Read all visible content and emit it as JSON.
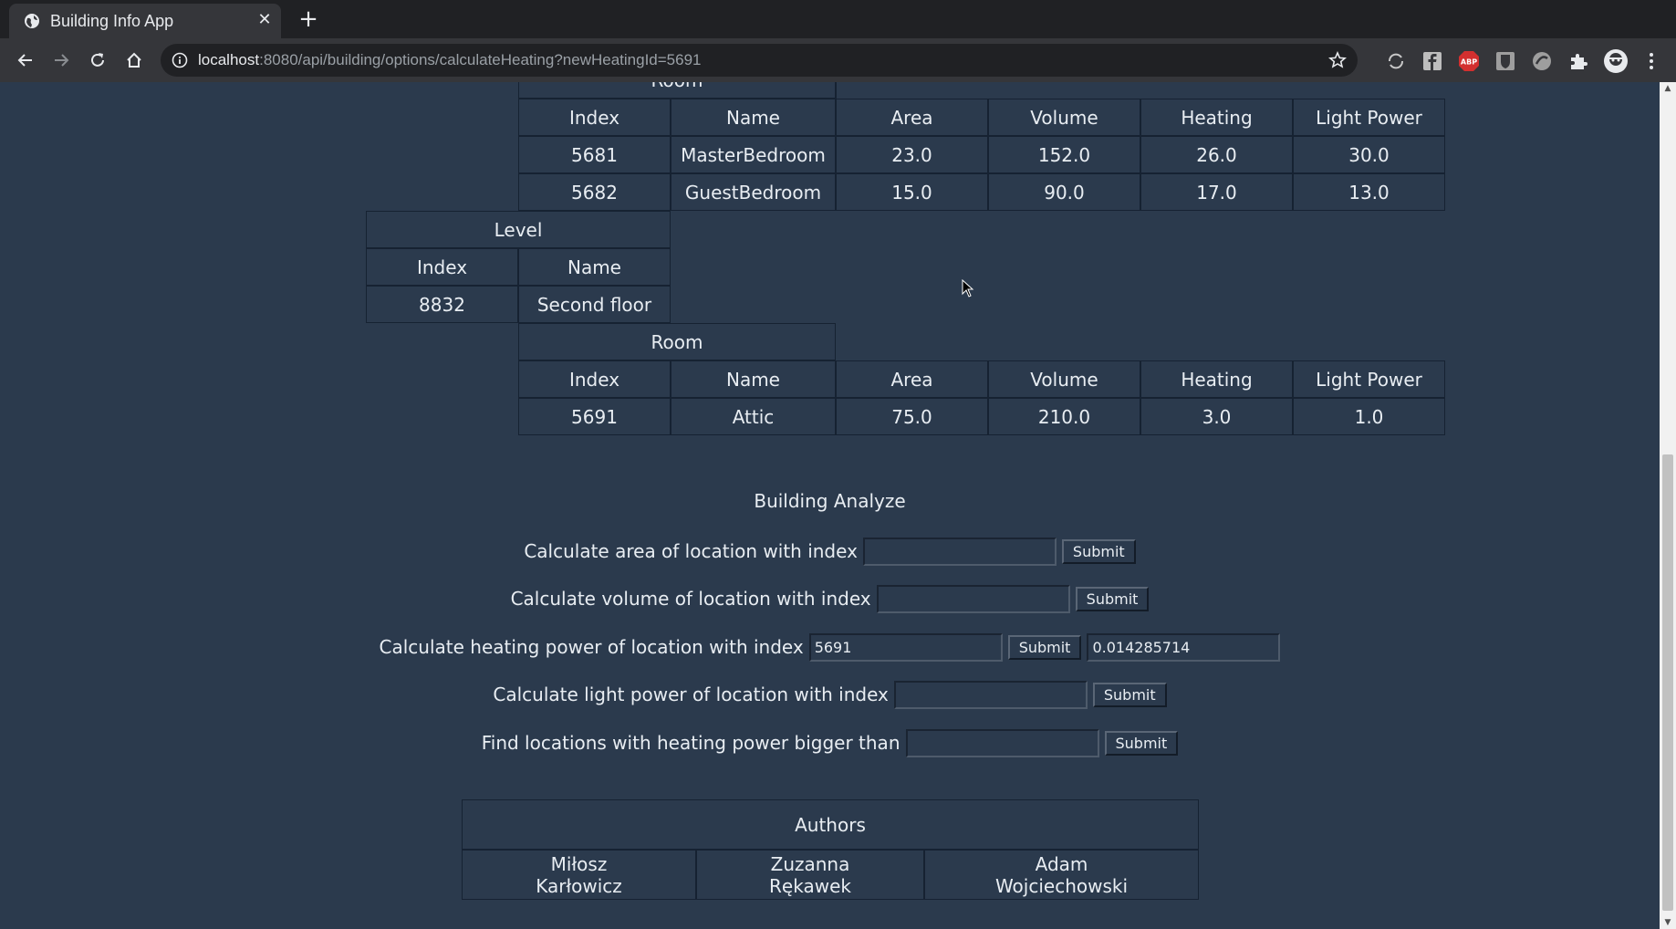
{
  "browser": {
    "tab_title": "Building Info App",
    "url_host": "localhost",
    "url_rest": ":8080/api/building/options/calculateHeating?newHeatingId=5691",
    "extension_icons": [
      "sync-icon",
      "facebook-icon",
      "adblock-plus-icon",
      "bitwarden-icon",
      "vpn-icon",
      "puzzle-icon",
      "profile-avatar-icon",
      "kebab-menu-icon"
    ]
  },
  "first_room_table": {
    "title": "Room",
    "headers": [
      "Index",
      "Name",
      "Area",
      "Volume",
      "Heating",
      "Light Power"
    ],
    "rows": [
      [
        "5681",
        "MasterBedroom",
        "23.0",
        "152.0",
        "26.0",
        "30.0"
      ],
      [
        "5682",
        "GuestBedroom",
        "15.0",
        "90.0",
        "17.0",
        "13.0"
      ]
    ]
  },
  "level_table": {
    "title": "Level",
    "headers": [
      "Index",
      "Name"
    ],
    "rows": [
      [
        "8832",
        "Second floor"
      ]
    ]
  },
  "second_room_table": {
    "title": "Room",
    "headers": [
      "Index",
      "Name",
      "Area",
      "Volume",
      "Heating",
      "Light Power"
    ],
    "rows": [
      [
        "5691",
        "Attic",
        "75.0",
        "210.0",
        "3.0",
        "1.0"
      ]
    ]
  },
  "analyze": {
    "title": "Building Analyze",
    "submit_label": "Submit",
    "forms": [
      {
        "label": "Calculate area of location with index",
        "value": "",
        "result": null
      },
      {
        "label": "Calculate volume of location with index",
        "value": "",
        "result": null
      },
      {
        "label": "Calculate heating power of location with index",
        "value": "5691",
        "result": "0.014285714"
      },
      {
        "label": "Calculate light power of location with index",
        "value": "",
        "result": null
      },
      {
        "label": "Find locations with heating power bigger than",
        "value": "",
        "result": null
      }
    ]
  },
  "authors": {
    "title": "Authors",
    "names": [
      [
        "Miłosz",
        "Karłowicz"
      ],
      [
        "Zuzanna",
        "Rękawek"
      ],
      [
        "Adam",
        "Wojciechowski"
      ]
    ]
  }
}
